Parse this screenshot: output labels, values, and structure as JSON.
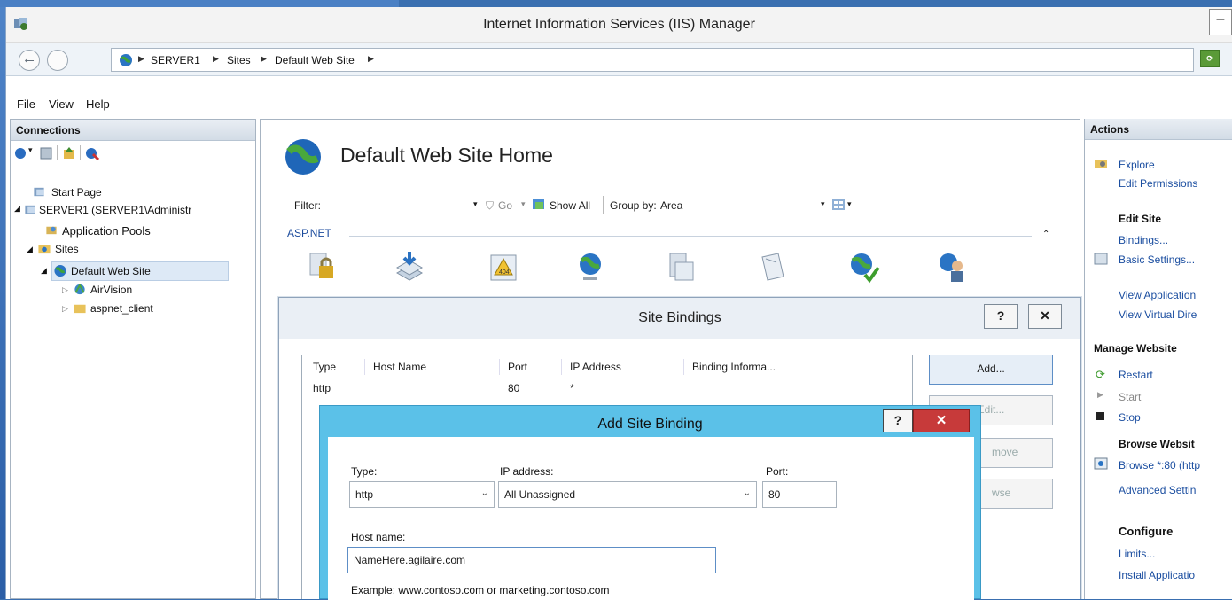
{
  "window": {
    "title": "Internet Information Services (IIS) Manager",
    "minimize": "–"
  },
  "address": {
    "crumbs": [
      "SERVER1",
      "Sites",
      "Default Web Site"
    ]
  },
  "menu": [
    "File",
    "View",
    "Help"
  ],
  "connections": {
    "header": "Connections",
    "tree": [
      {
        "label": "Start Page"
      },
      {
        "label": "SERVER1 (SERVER1\\Administr"
      },
      {
        "label": "Application Pools"
      },
      {
        "label": "Sites"
      },
      {
        "label": "Default Web Site"
      },
      {
        "label": "AirVision"
      },
      {
        "label": "aspnet_client"
      }
    ]
  },
  "center": {
    "title": "Default Web Site Home",
    "filter_label": "Filter:",
    "go": "Go",
    "show_all": "Show All",
    "group_by_label": "Group by:",
    "group_by_value": "Area",
    "section": "ASP.NET"
  },
  "actions": {
    "header": "Actions",
    "explore": "Explore",
    "edit_permissions": "Edit Permissions",
    "edit_site": "Edit Site",
    "bindings": "Bindings...",
    "basic_settings": "Basic Settings...",
    "view_applications": "View Application",
    "view_virtual": "View Virtual Dire",
    "manage_website": "Manage Website",
    "restart": "Restart",
    "start": "Start",
    "stop": "Stop",
    "browse_website": "Browse Websit",
    "browse_80": "Browse *:80 (http",
    "advanced_settings": "Advanced Settin",
    "configure": "Configure",
    "limits": "Limits...",
    "install_app": "Install Applicatio"
  },
  "site_bindings": {
    "title": "Site Bindings",
    "help": "?",
    "close": "✕",
    "columns": [
      "Type",
      "Host Name",
      "Port",
      "IP Address",
      "Binding Informa..."
    ],
    "row": {
      "type": "http",
      "host": "",
      "port": "80",
      "ip": "*",
      "info": ""
    },
    "add": "Add...",
    "edit": "Edit...",
    "remove": "move",
    "browse": "wse"
  },
  "add_binding": {
    "title": "Add Site Binding",
    "help": "?",
    "close": "✕",
    "type_label": "Type:",
    "type_value": "http",
    "ip_label": "IP address:",
    "ip_value": "All Unassigned",
    "port_label": "Port:",
    "port_value": "80",
    "host_label": "Host name:",
    "host_value": "NameHere.agilaire.com",
    "example": "Example: www.contoso.com or marketing.contoso.com"
  }
}
